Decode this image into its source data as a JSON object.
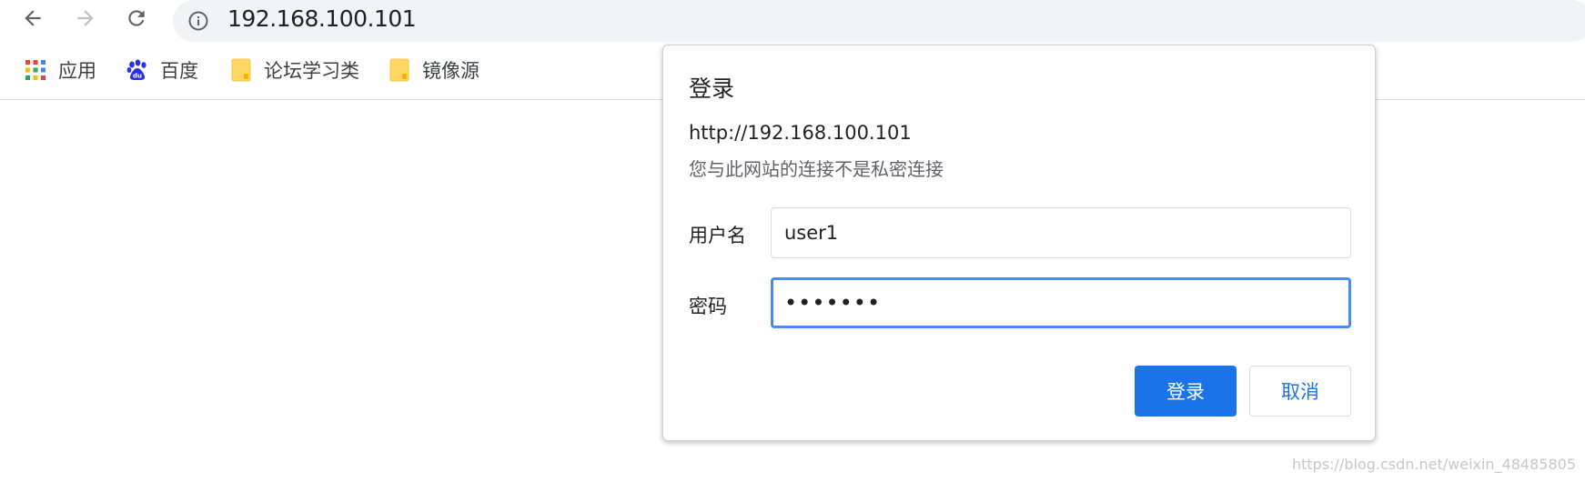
{
  "browser": {
    "address": "192.168.100.101"
  },
  "bookmarks": [
    {
      "label": "应用",
      "icon": "apps-grid-icon"
    },
    {
      "label": "百度",
      "icon": "baidu-paw-icon"
    },
    {
      "label": "论坛学习类",
      "icon": "folder-icon"
    },
    {
      "label": "镜像源",
      "icon": "folder-icon"
    }
  ],
  "dialog": {
    "title": "登录",
    "url": "http://192.168.100.101",
    "note": "您与此网站的连接不是私密连接",
    "username_label": "用户名",
    "username_value": "user1",
    "password_label": "密码",
    "password_value": "•••••••",
    "login_label": "登录",
    "cancel_label": "取消"
  },
  "watermark": "https://blog.csdn.net/weixin_48485805",
  "colors": {
    "accent": "#1a73e8",
    "focus_border": "#4a8af4",
    "folder": "#fdd663"
  }
}
